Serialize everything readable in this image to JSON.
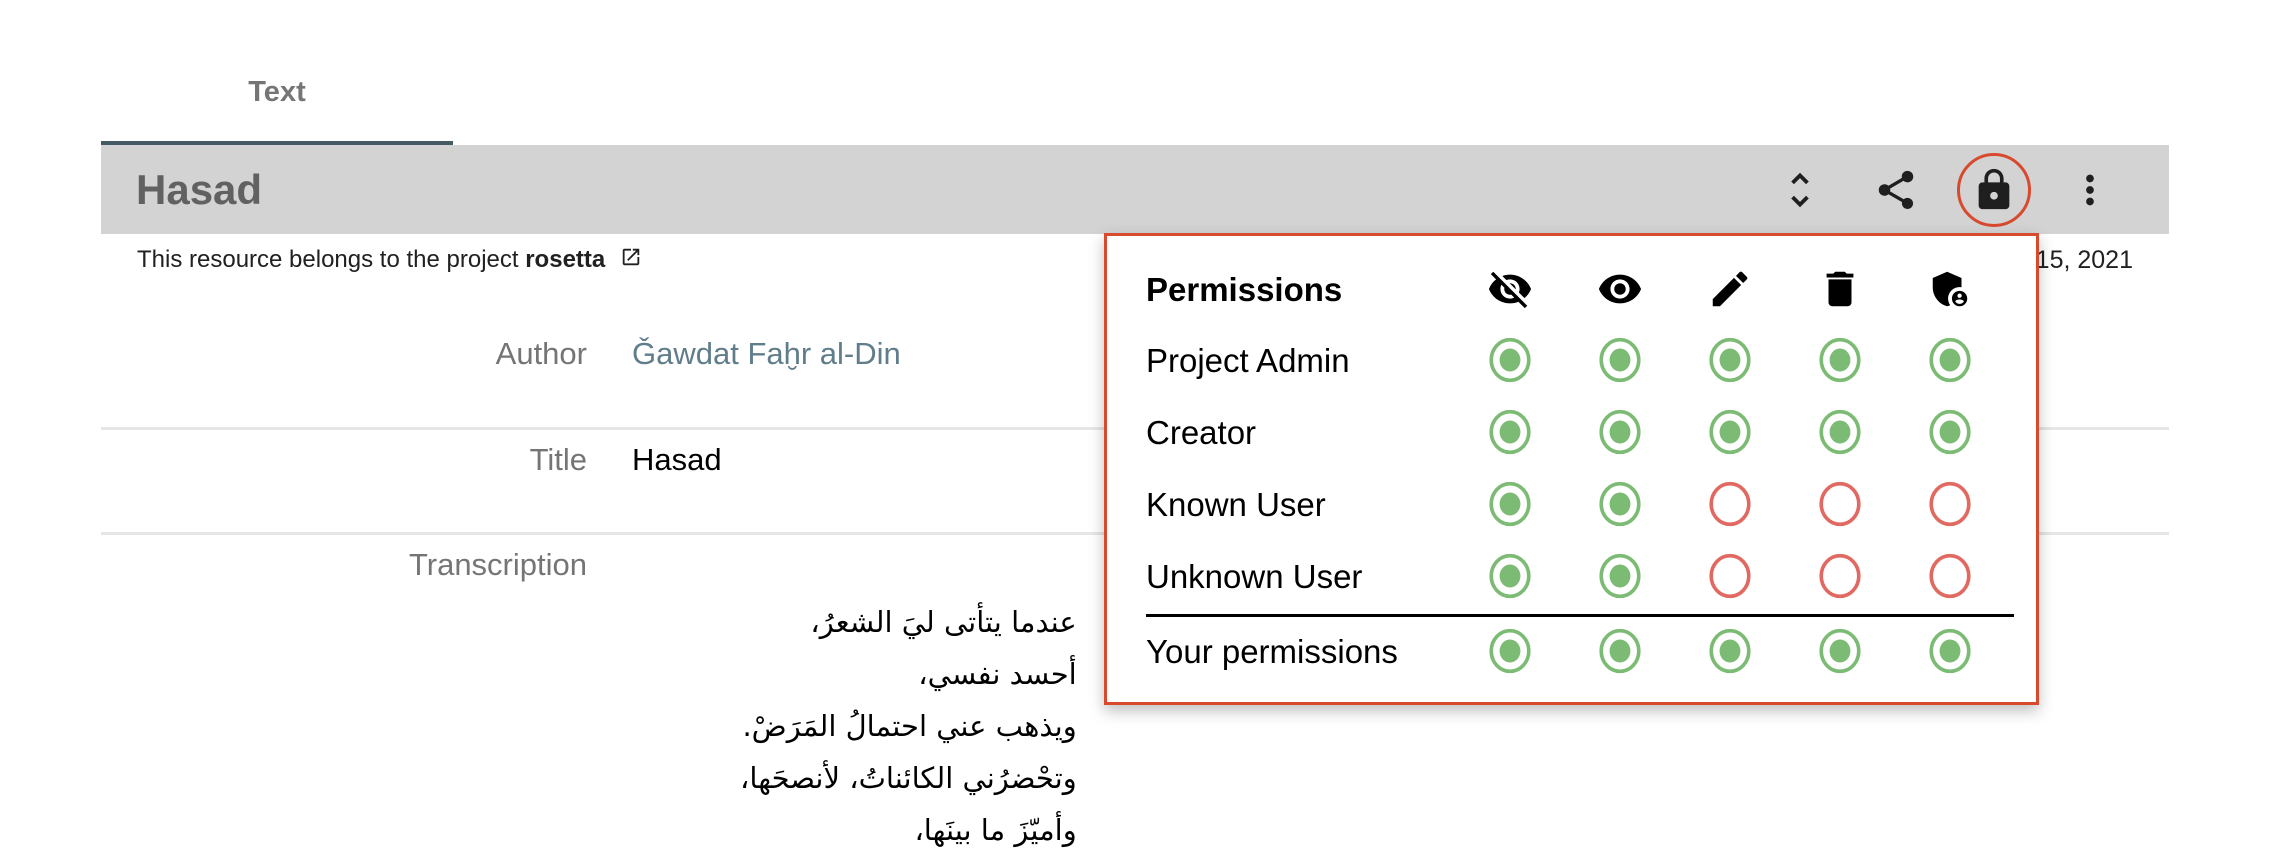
{
  "tabs": [
    {
      "label": "Text",
      "active": true
    }
  ],
  "header": {
    "title": "Hasad",
    "actions": [
      {
        "name": "expand-collapse",
        "icon": "unfold-more-icon"
      },
      {
        "name": "share",
        "icon": "share-icon"
      },
      {
        "name": "permissions",
        "icon": "lock-icon",
        "highlighted": true
      },
      {
        "name": "more",
        "icon": "more-vert-icon"
      }
    ]
  },
  "resource": {
    "prefix": "This resource belongs to the project",
    "project": "rosetta",
    "link_icon": "open-in-new-icon",
    "date_visible": "15, 2021"
  },
  "metadata": [
    {
      "label": "Author",
      "value": "Ǧawdat Faḫr al-Din",
      "is_link": true
    },
    {
      "label": "Title",
      "value": "Hasad"
    },
    {
      "label": "Transcription",
      "value": ""
    }
  ],
  "transcription_lines": [
    "عندما يتأتى ليَ الشعرُ،",
    "أحسد نفسي،",
    "ويذهب عني احتمالُ المَرَضْ.",
    "وتحْضرُني الكائناتُ، لأنصحَها،",
    "وأميّزَ ما بينَها،"
  ],
  "permissions": {
    "title": "Permissions",
    "columns": [
      {
        "name": "hidden",
        "icon": "visibility-off-icon"
      },
      {
        "name": "view",
        "icon": "visibility-icon"
      },
      {
        "name": "edit",
        "icon": "edit-icon"
      },
      {
        "name": "delete",
        "icon": "delete-icon"
      },
      {
        "name": "admin",
        "icon": "admin-shield-icon"
      }
    ],
    "rows": [
      {
        "label": "Project Admin",
        "values": [
          true,
          true,
          true,
          true,
          true
        ]
      },
      {
        "label": "Creator",
        "values": [
          true,
          true,
          true,
          true,
          true
        ]
      },
      {
        "label": "Known User",
        "values": [
          true,
          true,
          false,
          false,
          false
        ]
      },
      {
        "label": "Unknown User",
        "values": [
          true,
          true,
          false,
          false,
          false
        ]
      }
    ],
    "yours": {
      "label": "Your permissions",
      "values": [
        true,
        true,
        true,
        true,
        true
      ]
    }
  },
  "colors": {
    "granted": "#7cbb73",
    "denied": "#e06a62",
    "highlight": "#d84a2e",
    "tab_indicator": "#455a64",
    "header_bg": "#d3d3d3",
    "author_link": "#607d8b"
  }
}
